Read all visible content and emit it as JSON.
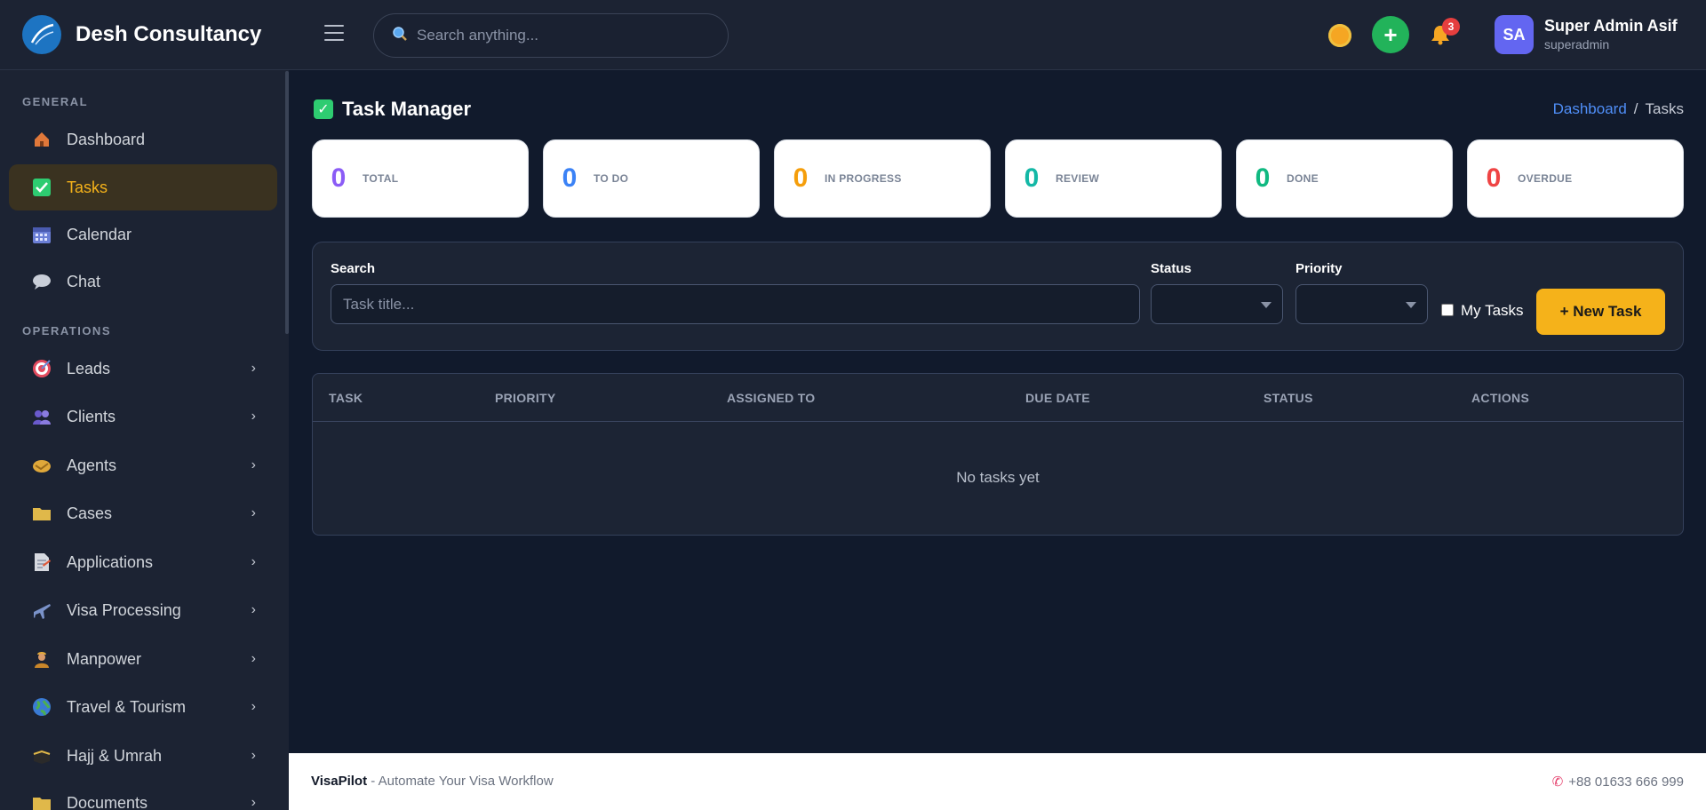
{
  "brand": {
    "name": "Desh Consultancy"
  },
  "header": {
    "search_placeholder": "Search anything...",
    "notification_count": "3",
    "user": {
      "initials": "SA",
      "name": "Super Admin Asif",
      "role": "superadmin"
    }
  },
  "sidebar": {
    "sections": [
      {
        "label": "GENERAL"
      },
      {
        "label": "OPERATIONS"
      }
    ],
    "items": [
      {
        "label": "Dashboard",
        "icon": "house-icon"
      },
      {
        "label": "Tasks",
        "icon": "checkbox-icon",
        "active": true
      },
      {
        "label": "Calendar",
        "icon": "calendar-icon"
      },
      {
        "label": "Chat",
        "icon": "chat-bubble-icon"
      },
      {
        "label": "Leads",
        "icon": "target-icon"
      },
      {
        "label": "Clients",
        "icon": "people-icon"
      },
      {
        "label": "Agents",
        "icon": "handshake-icon"
      },
      {
        "label": "Cases",
        "icon": "folder-icon"
      },
      {
        "label": "Applications",
        "icon": "document-icon"
      },
      {
        "label": "Visa Processing",
        "icon": "airplane-icon"
      },
      {
        "label": "Manpower",
        "icon": "worker-icon"
      },
      {
        "label": "Travel & Tourism",
        "icon": "globe-icon"
      },
      {
        "label": "Hajj & Umrah",
        "icon": "kaaba-icon"
      },
      {
        "label": "Documents",
        "icon": "folder-icon"
      }
    ]
  },
  "page": {
    "title": "Task Manager",
    "breadcrumb": {
      "home": "Dashboard",
      "current": "Tasks"
    }
  },
  "stats": [
    {
      "value": "0",
      "label": "TOTAL",
      "color": "#8b5cf6"
    },
    {
      "value": "0",
      "label": "TO DO",
      "color": "#3b82f6"
    },
    {
      "value": "0",
      "label": "IN PROGRESS",
      "color": "#f59e0b"
    },
    {
      "value": "0",
      "label": "REVIEW",
      "color": "#14b8a6"
    },
    {
      "value": "0",
      "label": "DONE",
      "color": "#10b981"
    },
    {
      "value": "0",
      "label": "OVERDUE",
      "color": "#ef4444"
    }
  ],
  "filters": {
    "search_label": "Search",
    "search_placeholder": "Task title...",
    "status_label": "Status",
    "priority_label": "Priority",
    "my_tasks_label": "My Tasks",
    "new_task_label": "+ New Task"
  },
  "table": {
    "columns": [
      "TASK",
      "PRIORITY",
      "ASSIGNED TO",
      "DUE DATE",
      "STATUS",
      "ACTIONS"
    ],
    "empty_text": "No tasks yet"
  },
  "footer": {
    "brand": "VisaPilot",
    "tagline": " - Automate Your Visa Workflow",
    "phone": "+88 01633 666 999"
  }
}
